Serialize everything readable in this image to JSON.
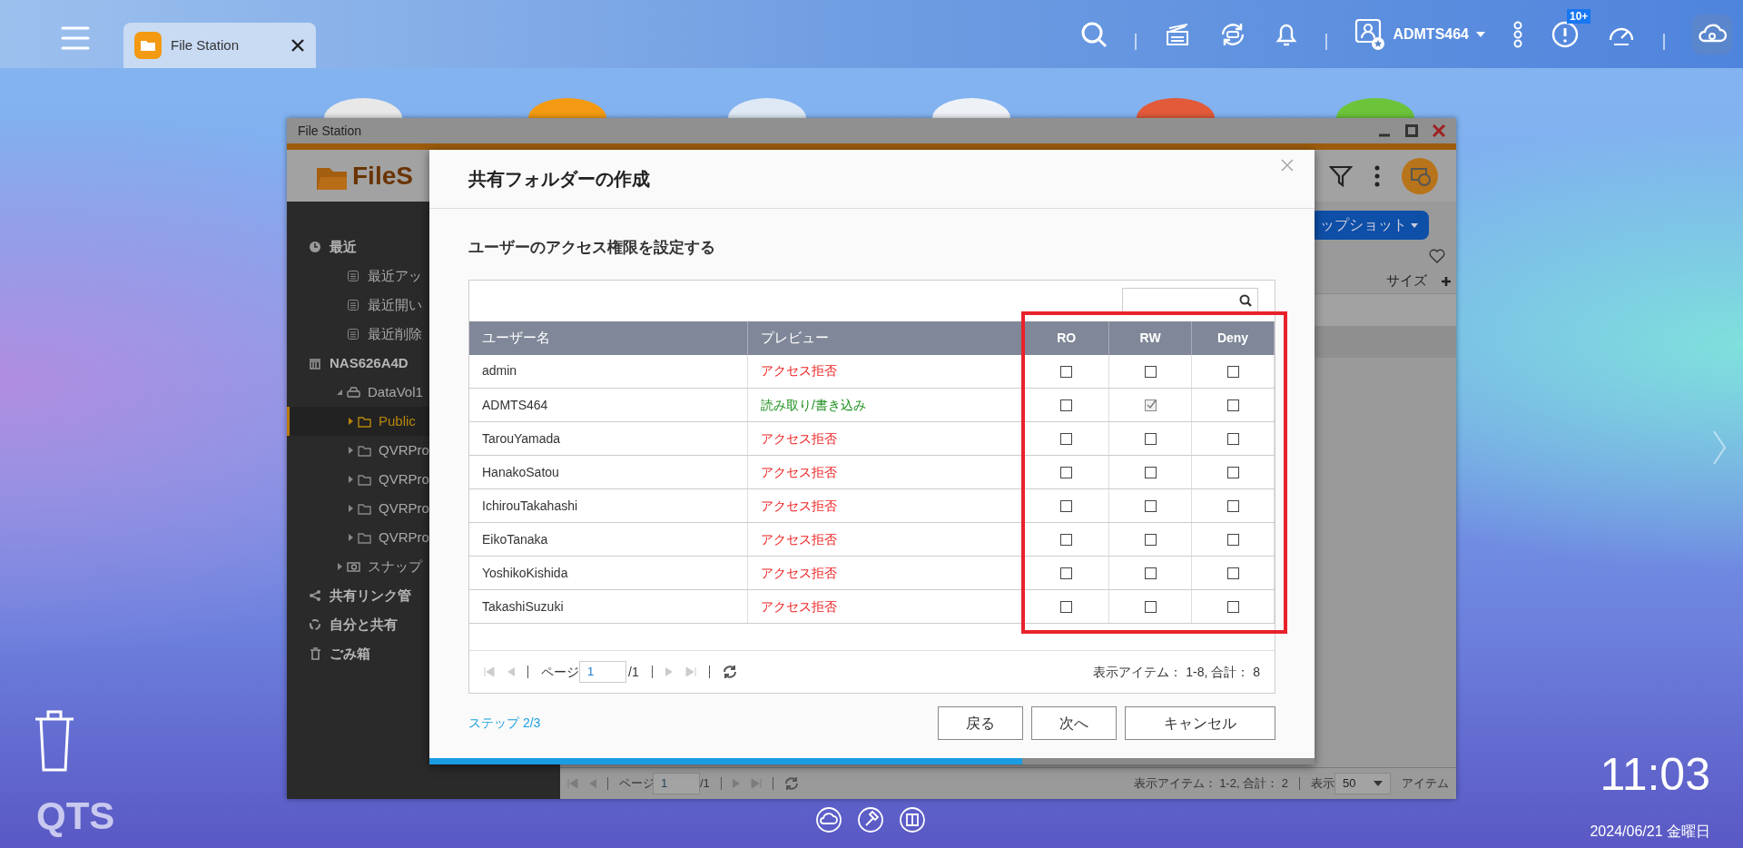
{
  "top_bar": {
    "tabs": [
      {
        "label": "File Station",
        "selected": true
      }
    ],
    "user": "ADMTS464",
    "notification_count": "10+"
  },
  "desktop": {
    "logo": "QTS",
    "clock": "11:03",
    "date": "2024/06/21 金曜日"
  },
  "window": {
    "title": "File Station",
    "app_name": "FileS",
    "sidebar": {
      "items": [
        {
          "label": "最近",
          "kind": "recent",
          "selected": false,
          "children": [
            {
              "label": "最近アッ",
              "kind": "list",
              "selected": false
            },
            {
              "label": "最近開い",
              "kind": "list",
              "selected": false
            },
            {
              "label": "最近削除",
              "kind": "list",
              "selected": false
            }
          ]
        },
        {
          "label": "NAS626A4D",
          "kind": "nas",
          "selected": false,
          "children": [
            {
              "label": "DataVol1",
              "kind": "volume",
              "selected": false,
              "expanded": true,
              "children": [
                {
                  "label": "Public",
                  "kind": "folder",
                  "selected": true,
                  "expanded": false
                },
                {
                  "label": "QVRPro",
                  "kind": "folder",
                  "selected": false,
                  "expanded": false
                },
                {
                  "label": "QVRPro",
                  "kind": "folder",
                  "selected": false,
                  "expanded": false
                },
                {
                  "label": "QVRPro",
                  "kind": "folder",
                  "selected": false,
                  "expanded": false
                },
                {
                  "label": "QVRPro",
                  "kind": "folder",
                  "selected": false,
                  "expanded": false
                }
              ]
            },
            {
              "label": "スナップ",
              "kind": "snapshot",
              "selected": false,
              "expanded": false
            }
          ]
        },
        {
          "label": "共有リンク管",
          "kind": "share",
          "selected": false
        },
        {
          "label": "自分と共有",
          "kind": "shared",
          "selected": false
        },
        {
          "label": "ごみ箱",
          "kind": "trash",
          "selected": false
        }
      ]
    },
    "toolbar_button": "ップショット",
    "columns": [
      "サイズ"
    ],
    "status_bar": {
      "page_label": "ページ",
      "page": "1",
      "page_total": "/1",
      "summary": "表示アイテム： 1-2, 合計： 2",
      "per_page_label": "表示",
      "per_page": "50",
      "per_page_unit": "アイテム"
    }
  },
  "dialog": {
    "title": "共有フォルダーの作成",
    "subtitle": "ユーザーのアクセス権限を設定する",
    "columns": [
      "ユーザー名",
      "プレビュー",
      "RO",
      "RW",
      "Deny"
    ],
    "rows": [
      {
        "user": "admin",
        "preview": "アクセス拒否",
        "color": "#ee1c1c",
        "ro": false,
        "rw": false,
        "deny": false
      },
      {
        "user": "ADMTS464",
        "preview": "読み取り/書き込み",
        "color": "#1b8f1b",
        "ro": false,
        "rw": true,
        "deny": false
      },
      {
        "user": "TarouYamada",
        "preview": "アクセス拒否",
        "color": "#ee1c1c",
        "ro": false,
        "rw": false,
        "deny": false
      },
      {
        "user": "HanakoSatou",
        "preview": "アクセス拒否",
        "color": "#ee1c1c",
        "ro": false,
        "rw": false,
        "deny": false
      },
      {
        "user": "IchirouTakahashi",
        "preview": "アクセス拒否",
        "color": "#ee1c1c",
        "ro": false,
        "rw": false,
        "deny": false
      },
      {
        "user": "EikoTanaka",
        "preview": "アクセス拒否",
        "color": "#ee1c1c",
        "ro": false,
        "rw": false,
        "deny": false
      },
      {
        "user": "YoshikoKishida",
        "preview": "アクセス拒否",
        "color": "#ee1c1c",
        "ro": false,
        "rw": false,
        "deny": false
      },
      {
        "user": "TakashiSuzuki",
        "preview": "アクセス拒否",
        "color": "#ee1c1c",
        "ro": false,
        "rw": false,
        "deny": false
      }
    ],
    "pager": {
      "page_label": "ページ",
      "page": "1",
      "page_total": "/1",
      "summary": "表示アイテム： 1-8, 合計： 8"
    },
    "step": "ステップ 2/3",
    "buttons": [
      "戻る",
      "次へ",
      "キャンセル"
    ],
    "progress": {
      "level": 0.67
    }
  }
}
